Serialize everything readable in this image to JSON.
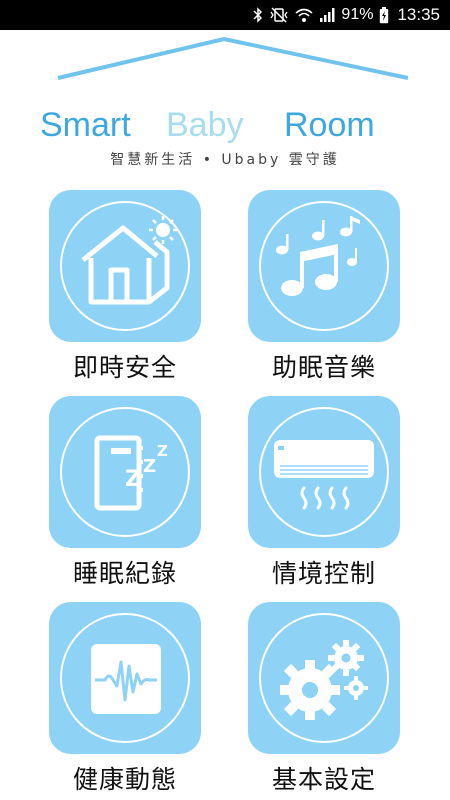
{
  "status_bar": {
    "battery_percent": "91%",
    "time": "13:35",
    "icons": [
      "bluetooth-icon",
      "vibrate-mute-icon",
      "wifi-icon",
      "signal-icon",
      "battery-icon"
    ]
  },
  "logo": {
    "smart": "Smart",
    "baby": "Baby",
    "room": "Room",
    "tagline": "智慧新生活 • Ubaby 雲守護",
    "colors": {
      "smart": "#3da7e0",
      "baby": "#a9dcef",
      "room": "#3da7e0",
      "roof": "#6fc3ec"
    }
  },
  "menu": [
    {
      "label": "即時安全",
      "icon": "house-icon"
    },
    {
      "label": "助眠音樂",
      "icon": "music-notes-icon"
    },
    {
      "label": "睡眠紀錄",
      "icon": "sleep-notebook-icon"
    },
    {
      "label": "情境控制",
      "icon": "air-conditioner-icon"
    },
    {
      "label": "健康動態",
      "icon": "waveform-icon"
    },
    {
      "label": "基本設定",
      "icon": "gears-icon"
    }
  ],
  "colors": {
    "tile": "#8ed3f5",
    "icon": "#ffffff"
  }
}
